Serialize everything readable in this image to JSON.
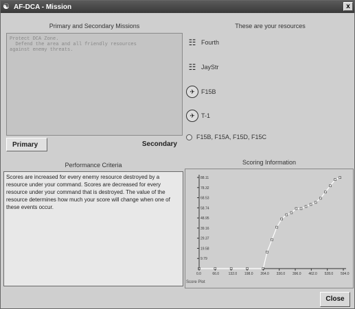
{
  "window": {
    "title": "AF-DCA - Mission",
    "close_glyph": "x"
  },
  "missions": {
    "header": "Primary and Secondary Missions",
    "text": "Protect DCA Zone.\n  Defend the area and all friendly resources\nagainst enemy threats.",
    "tabs": [
      {
        "label": "Primary"
      },
      {
        "label": "Secondary"
      }
    ]
  },
  "resources": {
    "header": "These are your resources",
    "items": [
      {
        "label": "Fourth",
        "icon": "unit-icon"
      },
      {
        "label": "JayStr",
        "icon": "unit-icon"
      },
      {
        "label": "F15B",
        "icon": "aircraft-icon"
      },
      {
        "label": "T-1",
        "icon": "aircraft-icon"
      },
      {
        "label": "F15B, F15A, F15D, F15C",
        "icon": "radio"
      }
    ]
  },
  "criteria": {
    "header": "Performance Criteria",
    "text": "Scores are increased for every enemy resource destroyed by a resource under your command. Scores are decreased for every resource under your command that is destroyed. The value of the resource determines how much your score will change when one of these events occur."
  },
  "scoring": {
    "header": "Scoring Information",
    "footer": "Score Plot",
    "colors": {
      "line": "#ffffff",
      "axis": "#333333",
      "point": "#444444"
    }
  },
  "chart_data": {
    "type": "line",
    "title": "",
    "xlabel": "",
    "ylabel": "",
    "x_ticks": [
      "0.0",
      "66.0",
      "132.0",
      "198.0",
      "264.0",
      "330.0",
      "396.0",
      "462.0",
      "528.0",
      "594.0"
    ],
    "y_ticks": [
      "9.79",
      "19.58",
      "29.37",
      "39.16",
      "48.95",
      "58.74",
      "68.53",
      "78.32",
      "88.11"
    ],
    "xlim": [
      0,
      594
    ],
    "ylim": [
      0,
      88.11
    ],
    "series": [
      {
        "x": [
          0,
          66,
          132,
          198,
          264,
          280,
          300,
          320,
          340,
          360,
          380,
          400,
          420,
          440,
          460,
          480,
          500,
          520,
          540,
          560,
          580
        ],
        "values": [
          0,
          0,
          0,
          0,
          0,
          16,
          28,
          40,
          48,
          52,
          54,
          58,
          58,
          60,
          62,
          64,
          68,
          74,
          80,
          86,
          88
        ]
      }
    ]
  },
  "buttons": {
    "close_label": "Close"
  }
}
